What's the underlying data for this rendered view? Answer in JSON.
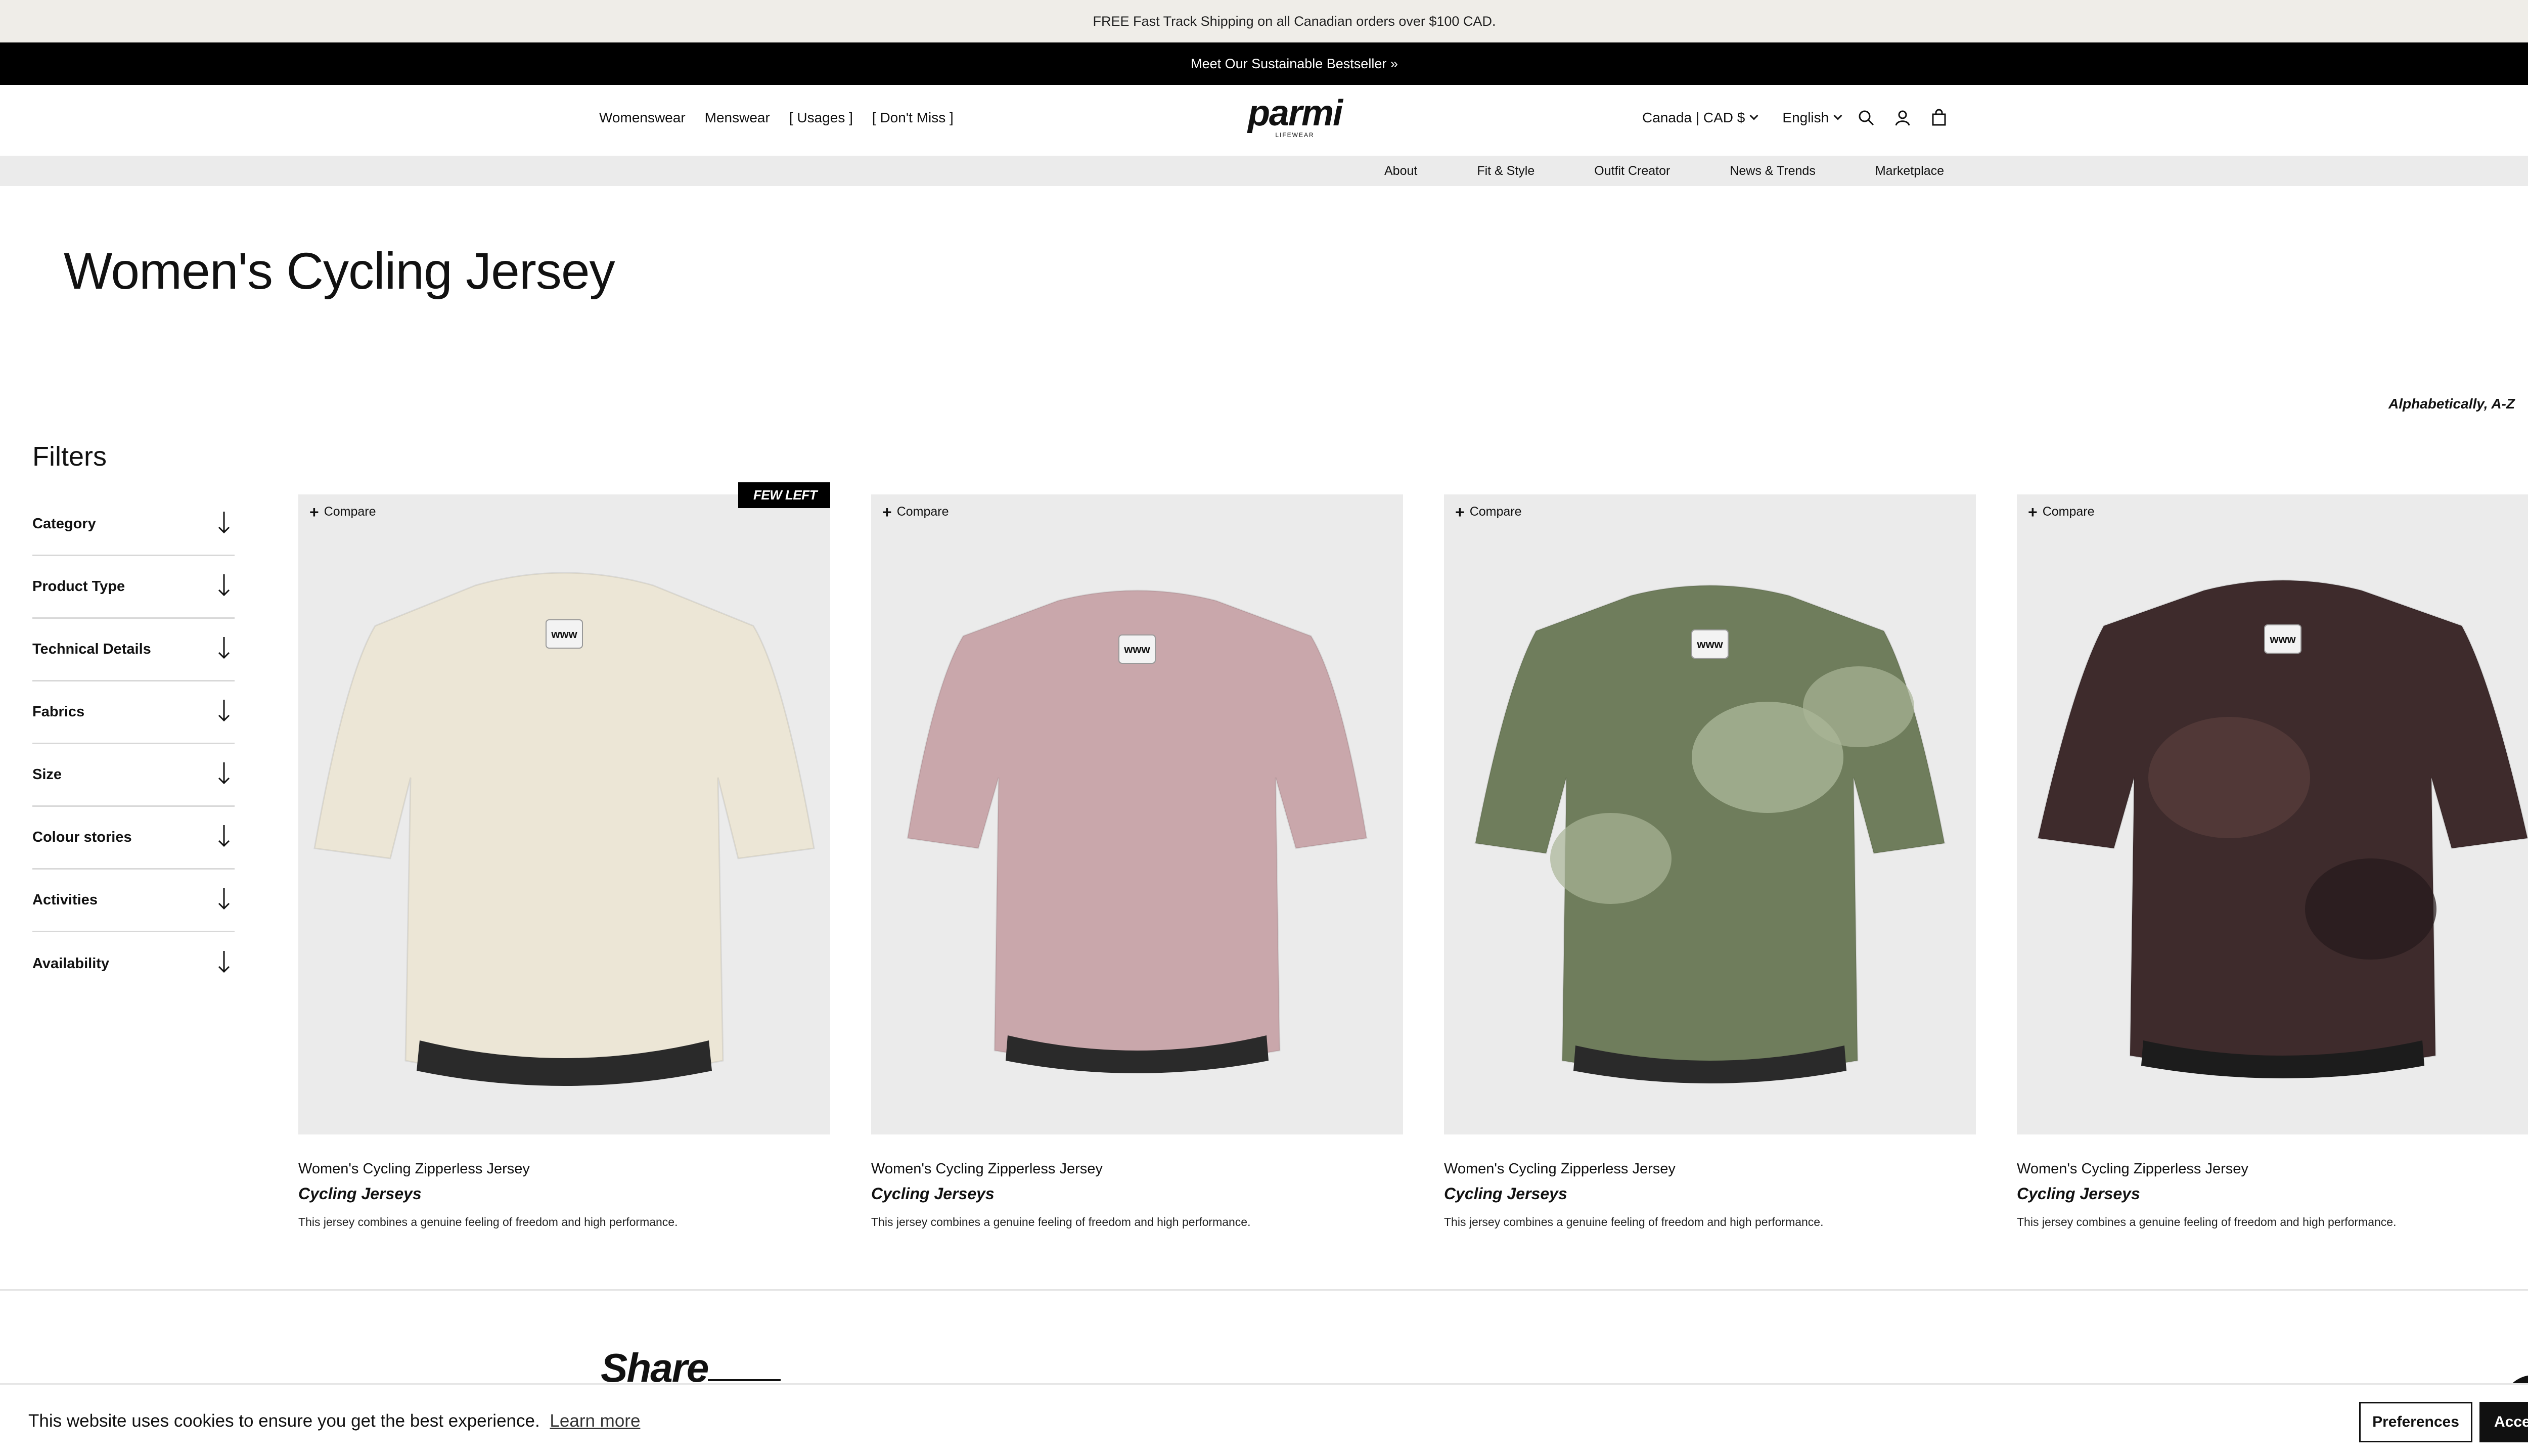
{
  "promo": {
    "text": "FREE Fast Track Shipping on all Canadian orders over $100 CAD."
  },
  "meet": {
    "text": "Meet Our Sustainable Bestseller »"
  },
  "header": {
    "nav_left": [
      "Womenswear",
      "Menswear",
      "[ Usages ]",
      "[ Don't Miss ]"
    ],
    "logo": {
      "word": "parmi",
      "sub": "LIFEWEAR"
    },
    "region": "Canada | CAD $",
    "language": "English",
    "icons": [
      "search-icon",
      "account-icon",
      "bag-icon"
    ]
  },
  "subnav": [
    "About",
    "Fit & Style",
    "Outfit Creator",
    "News & Trends",
    "Marketplace"
  ],
  "page": {
    "title": "Women's Cycling Jersey"
  },
  "sort": {
    "label": "Alphabetically, A-Z"
  },
  "filters": {
    "title": "Filters",
    "items": [
      "Category",
      "Product Type",
      "Technical Details",
      "Fabrics",
      "Size",
      "Colour stories",
      "Activities",
      "Availability"
    ]
  },
  "products": [
    {
      "compare": "Compare",
      "badge": "FEW LEFT",
      "name": "Women's Cycling Zipperless Jersey",
      "category": "Cycling Jerseys",
      "desc": "This jersey combines a genuine feeling of freedom and high performance.",
      "color": "#ece6d6"
    },
    {
      "compare": "Compare",
      "badge": "",
      "name": "Women's Cycling Zipperless Jersey",
      "category": "Cycling Jerseys",
      "desc": "This jersey combines a genuine feeling of freedom and high performance.",
      "color": "#c9a7ab"
    },
    {
      "compare": "Compare",
      "badge": "",
      "name": "Women's Cycling Zipperless Jersey",
      "category": "Cycling Jerseys",
      "desc": "This jersey combines a genuine feeling of freedom and high performance.",
      "color": "#6f7d5c"
    },
    {
      "compare": "Compare",
      "badge": "",
      "name": "Women's Cycling Zipperless Jersey",
      "category": "Cycling Jerseys",
      "desc": "This jersey combines a genuine feeling of freedom and high performance.",
      "color": "#3e2b2c"
    }
  ],
  "share": {
    "title": "Share"
  },
  "cookie": {
    "text": "This website uses cookies to ensure you get the best experience.",
    "learn_more": "Learn more",
    "preferences": "Preferences",
    "accept": "Accept"
  }
}
